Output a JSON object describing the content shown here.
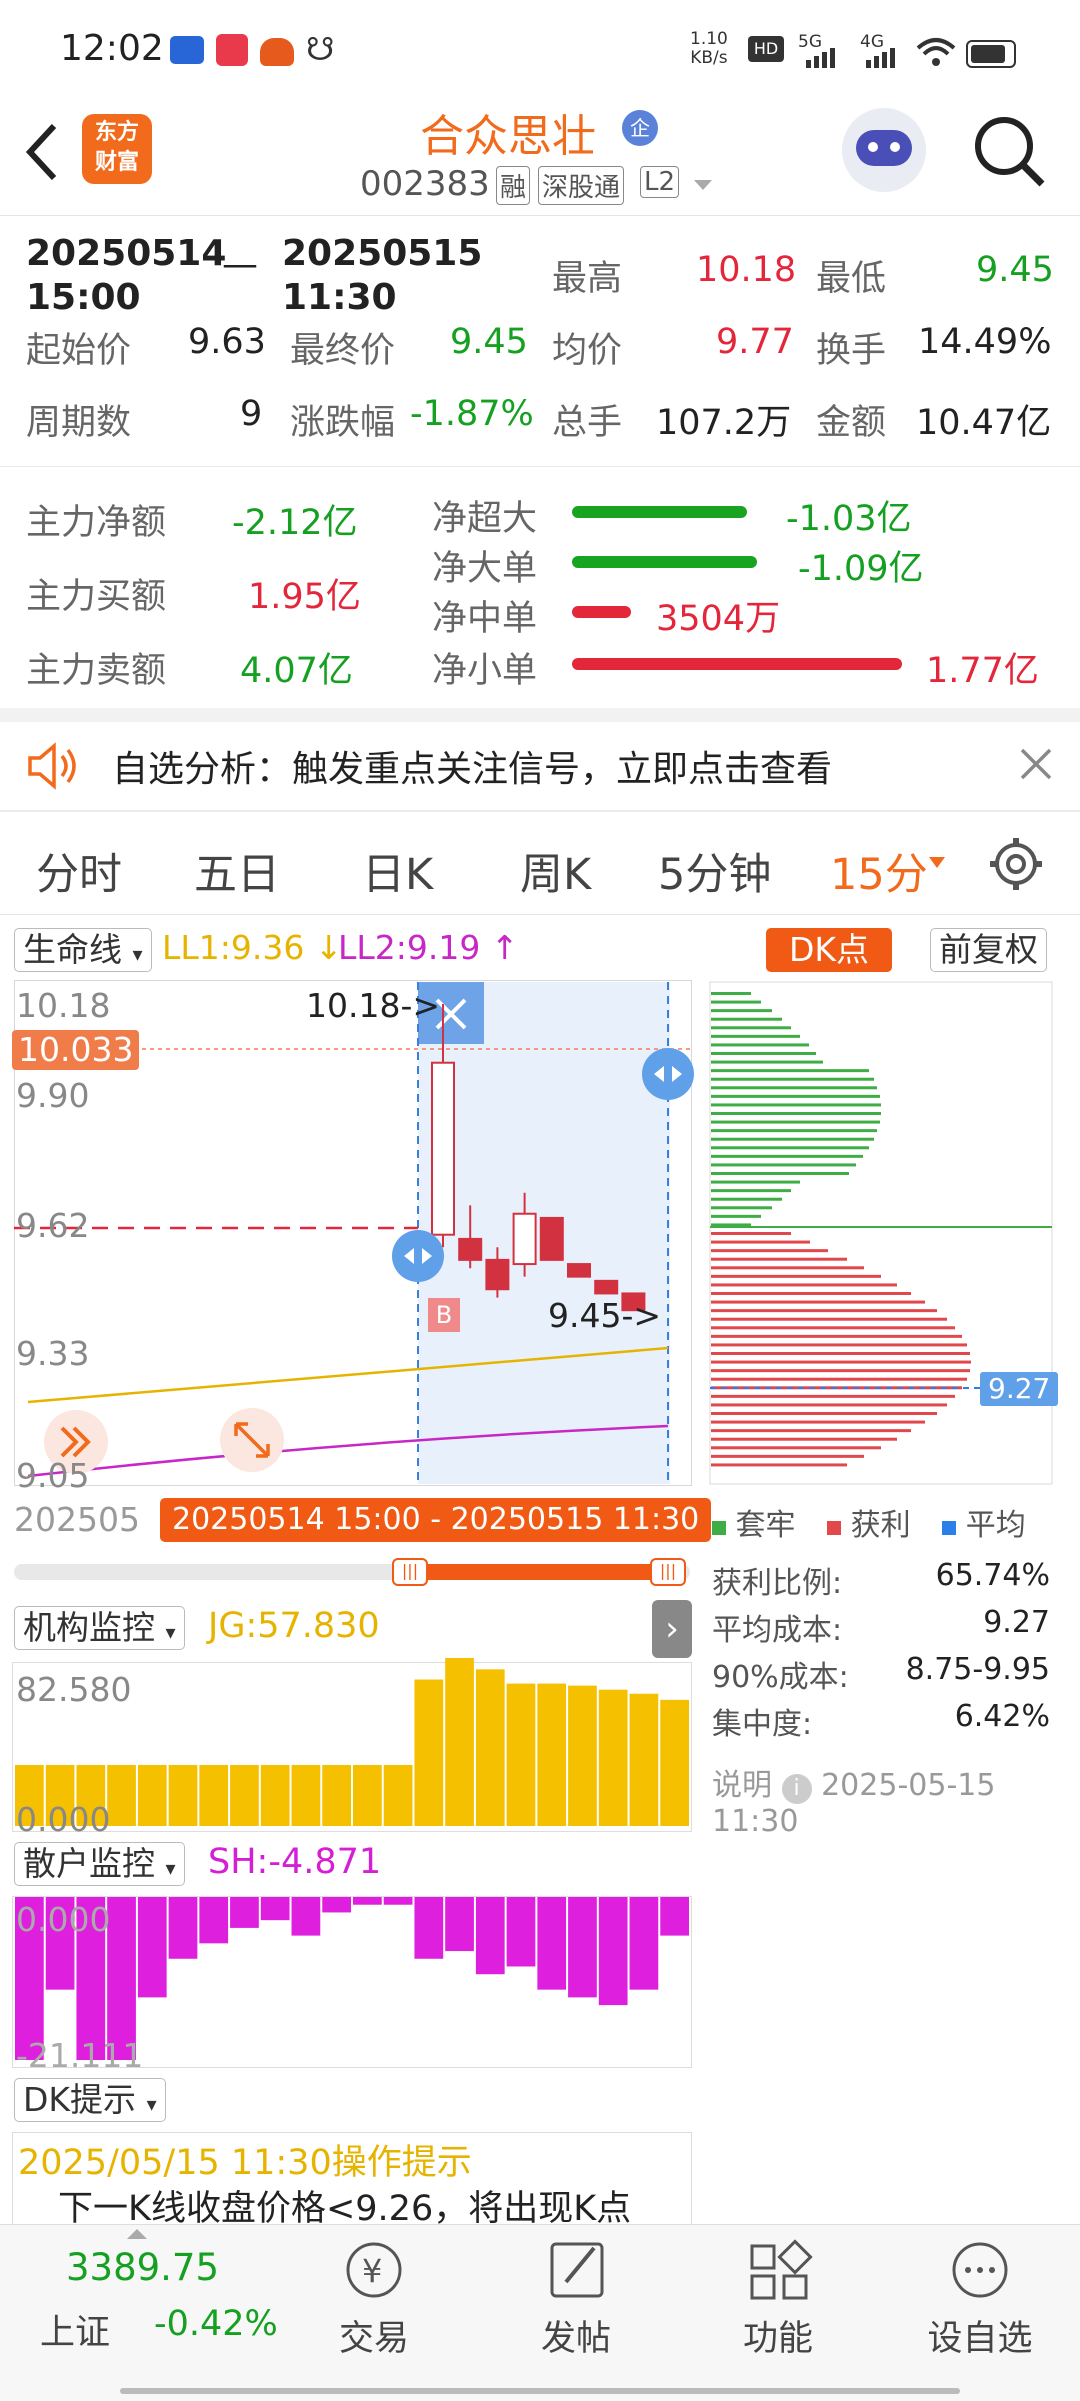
{
  "status": {
    "time": "12:02",
    "net_speed_top": "1.10",
    "net_speed_bottom": "KB/s",
    "hd": "HD",
    "sig1": "5G",
    "sig2": "4G"
  },
  "header": {
    "logo_line1": "东方",
    "logo_line2": "财富",
    "stock_name": "合众思壮",
    "badge": "企",
    "code": "002383",
    "tag1": "融",
    "tag2": "深股通",
    "tag3": "L2"
  },
  "range": {
    "start_date": "20250514",
    "start_time": "15:00",
    "dash": "—",
    "end_date": "20250515",
    "end_time": "11:30"
  },
  "stats": {
    "high_label": "最高",
    "high": "10.18",
    "low_label": "最低",
    "low": "9.45",
    "open_label": "起始价",
    "open": "9.63",
    "close_label": "最终价",
    "close": "9.45",
    "avg_label": "均价",
    "avg": "9.77",
    "turnover_label": "换手",
    "turnover": "14.49%",
    "periods_label": "周期数",
    "periods": "9",
    "change_label": "涨跌幅",
    "change": "-1.87%",
    "volume_label": "总手",
    "volume": "107.2万",
    "amount_label": "金额",
    "amount": "10.47亿"
  },
  "flow": {
    "net_label": "主力净额",
    "net": "-2.12亿",
    "buy_label": "主力买额",
    "buy": "1.95亿",
    "sell_label": "主力卖额",
    "sell": "4.07亿",
    "rows": [
      {
        "label": "净超大",
        "value": "-1.03亿",
        "fraction": 0.53,
        "color": "#18a321"
      },
      {
        "label": "净大单",
        "value": "-1.09亿",
        "fraction": 0.56,
        "color": "#18a321"
      },
      {
        "label": "净中单",
        "value": "3504万",
        "fraction": 0.18,
        "color": "#e3263a"
      },
      {
        "label": "净小单",
        "value": "1.77亿",
        "fraction": 1.0,
        "color": "#e3263a"
      }
    ]
  },
  "notice": {
    "text": "自选分析：触发重点关注信号，立即点击查看"
  },
  "tabs": [
    "分时",
    "五日",
    "日K",
    "周K",
    "5分钟",
    "15分"
  ],
  "active_tab": "15分",
  "chart_controls": {
    "indicator": "生命线",
    "ll1": "LL1:9.36 ↓",
    "ll2": "LL2:9.19 ↑",
    "dk": "DK点",
    "fq": "前复权"
  },
  "price_axis": [
    "10.18",
    "9.90",
    "9.62",
    "9.33",
    "9.05"
  ],
  "price_tag": "10.033",
  "annotations": {
    "high": "10.18->",
    "low": "9.45->",
    "buy_marker": "B",
    "cost_tag": "9.27",
    "date_cut": "202505",
    "range_label": "20250514 15:00 - 20250515 11:30"
  },
  "chip": {
    "legend": [
      "套牢",
      "获利",
      "平均"
    ],
    "legend_colors": [
      "#3fad46",
      "#e0484b",
      "#2c7ee8"
    ],
    "rows": [
      {
        "label": "获利比例:",
        "value": "65.74%"
      },
      {
        "label": "平均成本:",
        "value": "9.27"
      },
      {
        "label": "90%成本:",
        "value": "8.75-9.95"
      },
      {
        "label": "集中度:",
        "value": "6.42%"
      }
    ],
    "note_label": "说明",
    "note_date": "2025-05-15 11:30"
  },
  "chart_data": [
    {
      "type": "candlestick",
      "title": "",
      "ylim": [
        9.05,
        10.18
      ],
      "candles": [
        {
          "open": 9.63,
          "high": 10.18,
          "low": 9.6,
          "close": 10.04
        },
        {
          "open": 9.62,
          "high": 9.7,
          "low": 9.55,
          "close": 9.57
        },
        {
          "open": 9.57,
          "high": 9.6,
          "low": 9.48,
          "close": 9.5
        },
        {
          "open": 9.56,
          "high": 9.73,
          "low": 9.53,
          "close": 9.68
        },
        {
          "open": 9.67,
          "high": 9.67,
          "low": 9.57,
          "close": 9.57
        },
        {
          "open": 9.56,
          "high": 9.56,
          "low": 9.53,
          "close": 9.53
        },
        {
          "open": 9.52,
          "high": 9.52,
          "low": 9.49,
          "close": 9.49
        },
        {
          "open": 9.49,
          "high": 9.49,
          "low": 9.45,
          "close": 9.45
        }
      ]
    },
    {
      "type": "bar",
      "title": "机构监控",
      "value_label": "JG:57.830",
      "ylim": [
        0,
        82.58
      ],
      "values": [
        30,
        30,
        30,
        30,
        30,
        30,
        30,
        30,
        30,
        30,
        30,
        30,
        30,
        72,
        82.58,
        77,
        70,
        70,
        69,
        67,
        65,
        62
      ]
    },
    {
      "type": "bar",
      "title": "散户监控",
      "value_label": "SH:-4.871",
      "ylim": [
        -21.111,
        0
      ],
      "values": [
        -21.111,
        -12,
        -21.111,
        -21.111,
        -13,
        -8,
        -6,
        -4,
        -3,
        -5,
        -2,
        -1,
        -1,
        -8,
        -7,
        -10,
        -9,
        -12,
        -13,
        -14,
        -12,
        -5
      ]
    }
  ],
  "axes": {
    "jg_max": "82.580",
    "jg_min": "0.000",
    "sh_max": "0.000",
    "sh_min": "-21.111"
  },
  "dk": {
    "title": "DK提示",
    "time_line": "2025/05/15 11:30操作提示",
    "message": "下一K线收盘价格<9.26，将出现K点"
  },
  "bottom": {
    "index_value": "3389.75",
    "index_name": "上证",
    "index_change": "-0.42%",
    "nav": [
      "交易",
      "发帖",
      "功能",
      "设自选"
    ]
  }
}
